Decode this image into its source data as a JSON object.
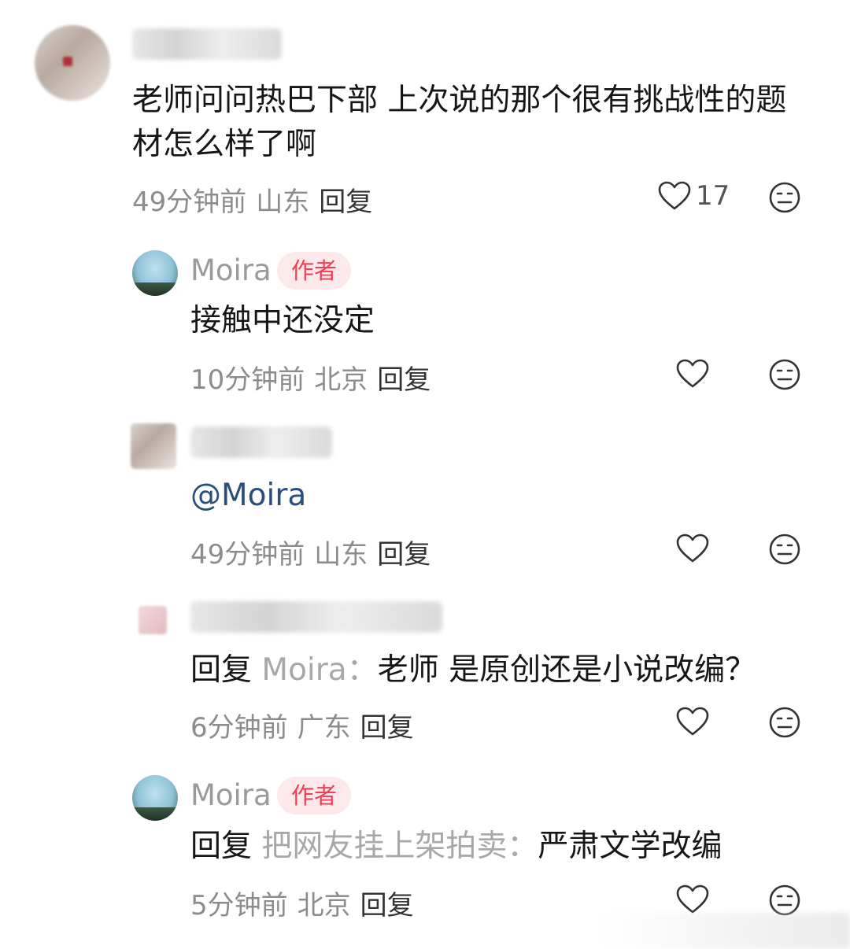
{
  "comments": [
    {
      "username": "",
      "content": "老师问问热巴下部 上次说的那个很有挑战性的题材怎么样了啊",
      "time": "49分钟前",
      "location": "山东",
      "reply_label": "回复",
      "likes": "17"
    },
    {
      "username": "Moira",
      "badge": "作者",
      "content": "接触中还没定",
      "time": "10分钟前",
      "location": "北京",
      "reply_label": "回复"
    },
    {
      "username": "",
      "content": "@Moira",
      "time": "49分钟前",
      "location": "山东",
      "reply_label": "回复"
    },
    {
      "username": "",
      "reply_prefix": "回复",
      "reply_to": "Moira：",
      "content": "老师 是原创还是小说改编？",
      "time": "6分钟前",
      "location": "广东",
      "reply_label": "回复"
    },
    {
      "username": "Moira",
      "badge": "作者",
      "reply_prefix": "回复",
      "reply_to": "把网友挂上架拍卖：",
      "content": "严肃文学改编",
      "time": "5分钟前",
      "location": "北京",
      "reply_label": "回复"
    }
  ],
  "icons": {
    "like": "heart-outline-icon",
    "dislike": "meh-face-icon"
  },
  "colors": {
    "badge_bg": "#fde8ea",
    "badge_text": "#ef3e55",
    "mention": "#2a4f7c",
    "meta": "#8c8c8c"
  }
}
